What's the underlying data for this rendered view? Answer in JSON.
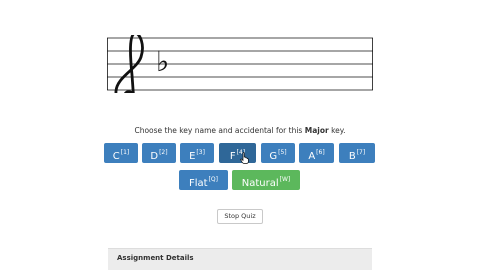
{
  "staff": {
    "clef": "treble",
    "key_signature": [
      "flat"
    ]
  },
  "prompt": {
    "before": "Choose the key name and accidental for this ",
    "emphasis": "Major",
    "after": " key."
  },
  "note_buttons": [
    {
      "label": "C",
      "shortcut": "[1]"
    },
    {
      "label": "D",
      "shortcut": "[2]"
    },
    {
      "label": "E",
      "shortcut": "[3]"
    },
    {
      "label": "F",
      "shortcut": "[4]",
      "state": "hover"
    },
    {
      "label": "G",
      "shortcut": "[5]"
    },
    {
      "label": "A",
      "shortcut": "[6]"
    },
    {
      "label": "B",
      "shortcut": "[7]"
    }
  ],
  "accidental_buttons": [
    {
      "label": "Flat",
      "shortcut": "[Q]"
    },
    {
      "label": "Natural",
      "shortcut": "[W]",
      "state": "selected"
    }
  ],
  "stop_button": "Stop Quiz",
  "assignment": {
    "title": "Assignment Details"
  },
  "colors": {
    "button": "#3d7fbd",
    "button_hover": "#2f6798",
    "selected": "#5cb85c"
  },
  "icons": {
    "cursor": "hand-pointer-icon"
  }
}
